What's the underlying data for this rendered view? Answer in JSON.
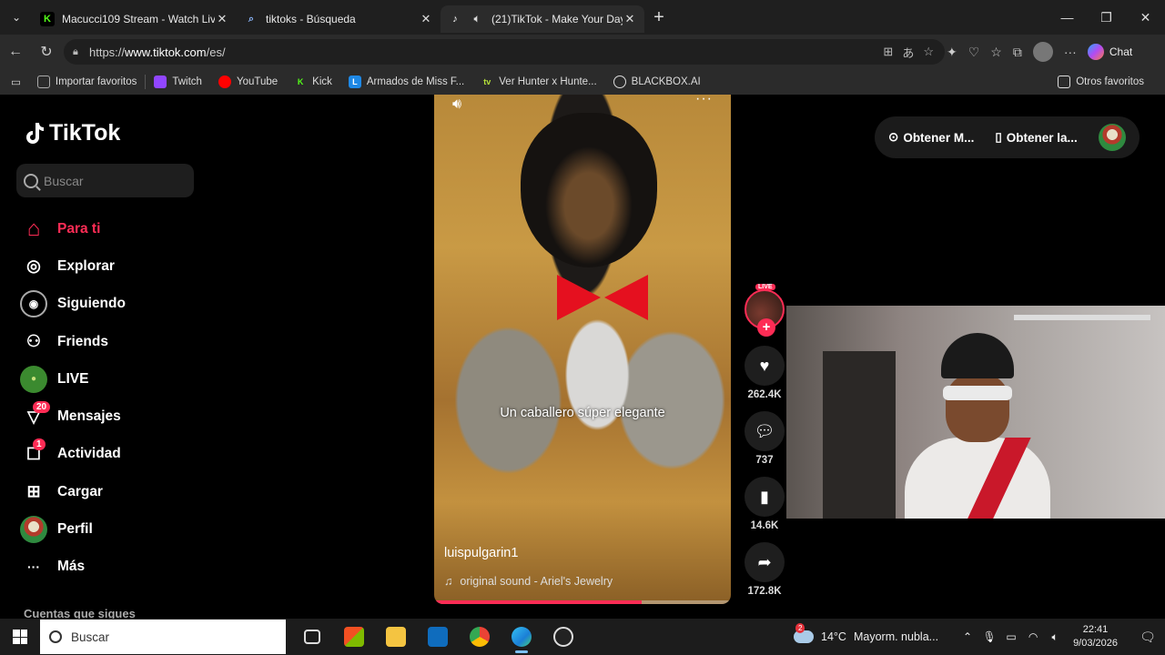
{
  "browser": {
    "tabs": [
      {
        "title": "Macucci109 Stream - Watch Live o",
        "favicon_color": "#53fc18",
        "favicon_letter": "K"
      },
      {
        "title": "tiktoks - Búsqueda",
        "favicon_color": "#2b2b2b",
        "favicon_letter": "Q"
      },
      {
        "title": "(21)TikTok - Make Your Day",
        "favicon_color": "#000000",
        "favicon_letter": "♪"
      }
    ],
    "url_prefix": "https://",
    "url_host": "www.tiktok.com",
    "url_path": "/es/",
    "chat_label": "Chat",
    "bookmarks": [
      {
        "label": "Importar favoritos",
        "icon_color": "#444"
      },
      {
        "label": "Twitch",
        "icon_color": "#9146ff"
      },
      {
        "label": "YouTube",
        "icon_color": "#ff0000"
      },
      {
        "label": "Kick",
        "icon_color": "#53fc18"
      },
      {
        "label": "Armados de Miss F...",
        "icon_color": "#1e88e5"
      },
      {
        "label": "Ver Hunter x Hunte...",
        "icon_color": "#222"
      },
      {
        "label": "BLACKBOX.AI",
        "icon_color": "#222"
      }
    ],
    "other_favorites": "Otros favoritos"
  },
  "tiktok": {
    "brand": "TikTok",
    "search_placeholder": "Buscar",
    "nav": [
      {
        "label": "Para ti",
        "icon": "home-icon",
        "glyph": "⌂"
      },
      {
        "label": "Explorar",
        "icon": "compass-icon",
        "glyph": "◎"
      },
      {
        "label": "Siguiendo",
        "icon": "following-icon",
        "glyph": "◉"
      },
      {
        "label": "Friends",
        "icon": "friends-icon",
        "glyph": "⚇"
      },
      {
        "label": "LIVE",
        "icon": "live-icon",
        "glyph": "●"
      },
      {
        "label": "Mensajes",
        "icon": "messages-icon",
        "glyph": "▽",
        "badge": "20"
      },
      {
        "label": "Actividad",
        "icon": "activity-icon",
        "glyph": "☐",
        "badge": "1"
      },
      {
        "label": "Cargar",
        "icon": "upload-icon",
        "glyph": "⊞"
      },
      {
        "label": "Perfil",
        "icon": "profile-icon",
        "glyph": "●"
      },
      {
        "label": "Más",
        "icon": "more-icon",
        "glyph": "···"
      }
    ],
    "following_title": "Cuentas que sigues",
    "video": {
      "caption": "Un caballero súper elegante",
      "author": "luispulgarin1",
      "sound": "original sound - Ariel's Jewelry",
      "progress": 0.7,
      "live_tag": "LIVE"
    },
    "actions": {
      "likes": "262.4K",
      "comments": "737",
      "saves": "14.6K",
      "shares": "172.8K"
    },
    "top_bar": {
      "item1": "Obtener M...",
      "item2": "Obtener la..."
    }
  },
  "taskbar": {
    "search_placeholder": "Buscar",
    "weather_temp": "14°C",
    "weather_desc": "Mayorm. nubla...",
    "weather_badge": "2",
    "time": "22:41",
    "date": "9/03/2026"
  }
}
